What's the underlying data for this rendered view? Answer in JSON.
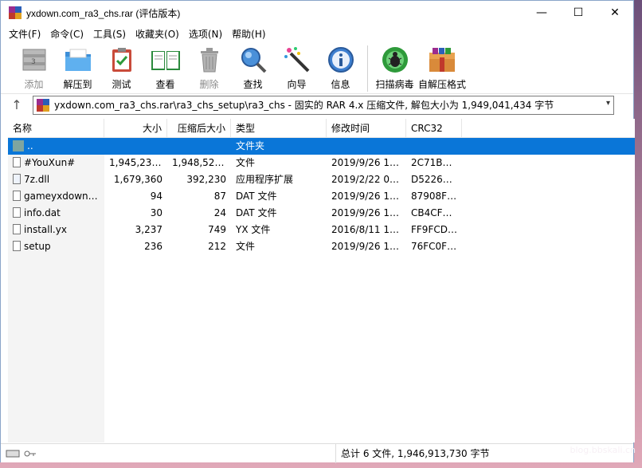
{
  "window": {
    "title": "yxdown.com_ra3_chs.rar (评估版本)",
    "minimize_glyph": "—",
    "maximize_glyph": "☐",
    "close_glyph": "✕"
  },
  "menu": [
    "文件(F)",
    "命令(C)",
    "工具(S)",
    "收藏夹(O)",
    "选项(N)",
    "帮助(H)"
  ],
  "toolbar": {
    "add": "添加",
    "extract_to": "解压到",
    "test": "测试",
    "view": "查看",
    "delete": "删除",
    "find": "查找",
    "wizard": "向导",
    "info": "信息",
    "virus_scan": "扫描病毒",
    "sfx": "自解压格式"
  },
  "pathbar": {
    "up_glyph": "↑",
    "path": "yxdown.com_ra3_chs.rar\\ra3_chs_setup\\ra3_chs - 固实的 RAR 4.x 压缩文件, 解包大小为 1,949,041,434 字节",
    "dropdown_glyph": "▾"
  },
  "columns": {
    "name": "名称",
    "size": "大小",
    "packed": "压缩后大小",
    "type": "类型",
    "modified": "修改时间",
    "crc": "CRC32"
  },
  "files": [
    {
      "name": "..",
      "size": "",
      "packed": "",
      "type": "文件夹",
      "modified": "",
      "crc": "",
      "kind": "folder",
      "selected": true
    },
    {
      "name": "#YouXun#",
      "size": "1,945,230,...",
      "packed": "1,948,524,...",
      "type": "文件",
      "modified": "2019/9/26 16...",
      "crc": "2C71BA...",
      "kind": "file"
    },
    {
      "name": "7z.dll",
      "size": "1,679,360",
      "packed": "392,230",
      "type": "应用程序扩展",
      "modified": "2019/2/22 0:00",
      "crc": "D5226149",
      "kind": "dll"
    },
    {
      "name": "gameyxdown....",
      "size": "94",
      "packed": "87",
      "type": "DAT 文件",
      "modified": "2019/9/26 16...",
      "crc": "87908FBC",
      "kind": "file"
    },
    {
      "name": "info.dat",
      "size": "30",
      "packed": "24",
      "type": "DAT 文件",
      "modified": "2019/9/26 16...",
      "crc": "CB4CF95E",
      "kind": "file"
    },
    {
      "name": "install.yx",
      "size": "3,237",
      "packed": "749",
      "type": "YX 文件",
      "modified": "2016/8/11 12...",
      "crc": "FF9FCD56",
      "kind": "file"
    },
    {
      "name": "setup",
      "size": "236",
      "packed": "212",
      "type": "文件",
      "modified": "2019/9/26 16...",
      "crc": "76FC0FB8",
      "kind": "file"
    }
  ],
  "status": {
    "summary": "总计 6 文件, 1,946,913,730 字节"
  },
  "watermark": "blog.bbskali.cn",
  "colors": {
    "selection": "#0a76d8",
    "rar_red": "#c0392b",
    "rar_blue": "#2b5fb8"
  }
}
